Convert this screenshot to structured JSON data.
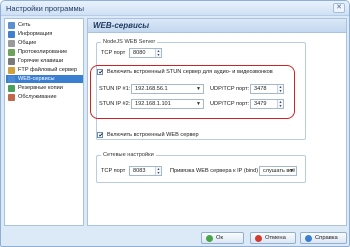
{
  "window": {
    "title": "Настройки программы",
    "close_glyph": "✕"
  },
  "sidebar": {
    "items": [
      {
        "label": "Сеть",
        "icon": "network-icon",
        "color": "#5b8fd0",
        "selected": false
      },
      {
        "label": "Информация",
        "icon": "info-icon",
        "color": "#3f7fcc",
        "selected": false
      },
      {
        "label": "Общие",
        "icon": "gear-icon",
        "color": "#9a9a9a",
        "selected": false
      },
      {
        "label": "Протоколирование",
        "icon": "log-icon",
        "color": "#6fa35b",
        "selected": false
      },
      {
        "label": "Горячие клавиши",
        "icon": "keyboard-icon",
        "color": "#7a7a7a",
        "selected": false
      },
      {
        "label": "FTP файловый сервер",
        "icon": "ftp-icon",
        "color": "#d1a13b",
        "selected": false
      },
      {
        "label": "WEB-сервисы",
        "icon": "web-icon",
        "color": "#4b8bd6",
        "selected": true
      },
      {
        "label": "Резервные копии",
        "icon": "backup-icon",
        "color": "#4aa05a",
        "selected": false
      },
      {
        "label": "Обслуживание",
        "icon": "maintenance-icon",
        "color": "#c2674a",
        "selected": false
      }
    ]
  },
  "panel": {
    "title": "WEB-сервисы",
    "nodejs_group": {
      "title": "NodeJS WEB Server",
      "tcp_label": "TCP порт",
      "tcp_value": "8080",
      "stun_checkbox_label": "Включить встроенный STUN сервер для аудио- и видеозвонков",
      "stun1_label": "STUN IP #1:",
      "stun1_value": "192.168.56.1",
      "stun2_label": "STUN IP #2:",
      "stun2_value": "192.168.1.101",
      "udp1_label": "UDP/TCP порт:",
      "udp1_value": "3478",
      "udp2_label": "UDP/TCP порт:",
      "udp2_value": "3479"
    },
    "web_checkbox_label": "Включить встроенный WEB сервер",
    "network_group": {
      "title": "Сетевые настройки",
      "tcp_label": "TCP порт",
      "tcp_value": "8083",
      "bind_label": "Привязка WEB сервера к IP (bind)",
      "bind_value": "слушать всё"
    }
  },
  "buttons": {
    "ok": "Ок",
    "cancel": "Отмена",
    "help": "Справка"
  },
  "colors": {
    "accent": "#3b7fd1",
    "highlight": "#d42020"
  }
}
